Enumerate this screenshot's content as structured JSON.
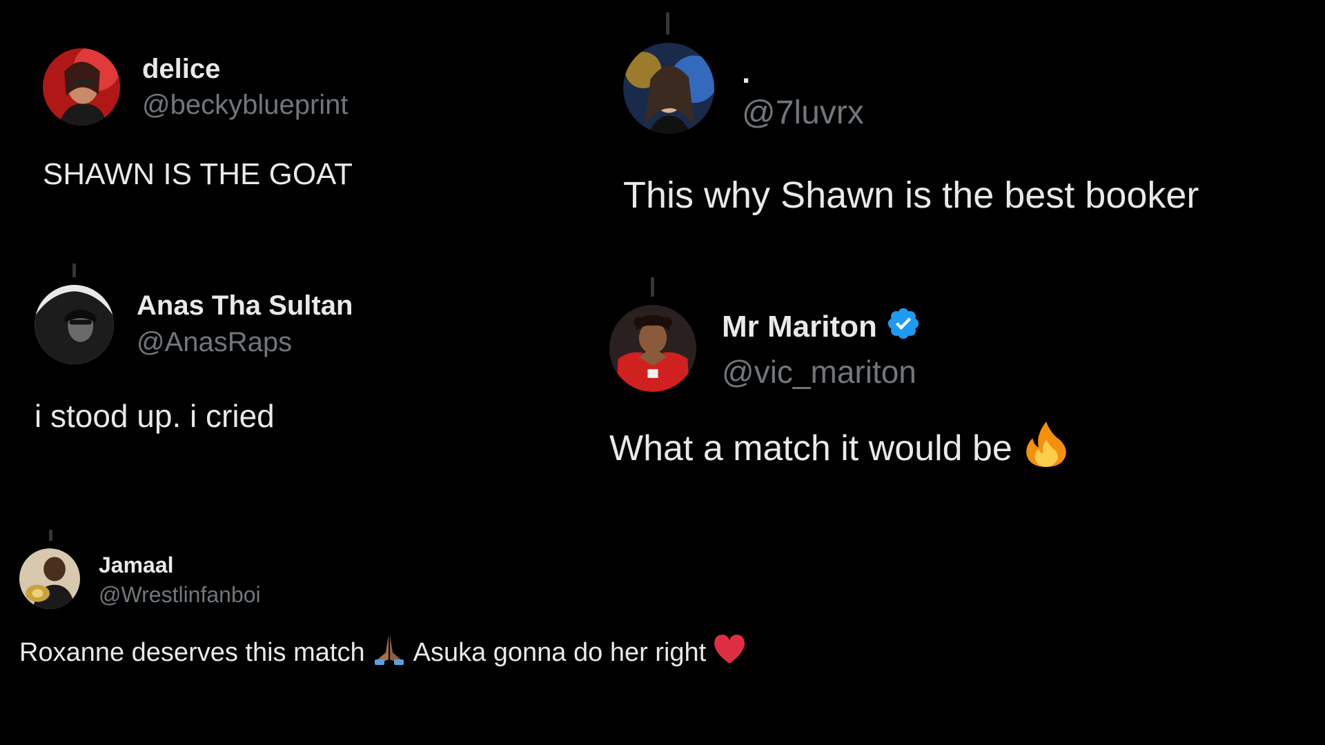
{
  "tweets": [
    {
      "name": "delice",
      "handle": "@beckyblueprint",
      "text": "SHAWN IS THE GOAT"
    },
    {
      "name": ".",
      "handle": "@7luvrx",
      "text": "This why Shawn is the best booker"
    },
    {
      "name": "Anas Tha Sultan",
      "handle": "@AnasRaps",
      "text": "i stood up. i cried"
    },
    {
      "name": "Mr Mariton",
      "handle": "@vic_mariton",
      "text": "What a match it would be",
      "emoji": "fire-emoji",
      "verified": true
    },
    {
      "name": "Jamaal",
      "handle": "@Wrestlinfanboi",
      "text_part1": "Roxanne deserves this match",
      "emoji1": "folded-hands-emoji",
      "text_part2": "Asuka gonna do her right",
      "emoji2": "red-heart-emoji"
    }
  ],
  "colors": {
    "background": "#000000",
    "text": "#e7e9ea",
    "handle": "#71767b",
    "verified": "#1d9bf0",
    "thread_line": "#333639"
  }
}
